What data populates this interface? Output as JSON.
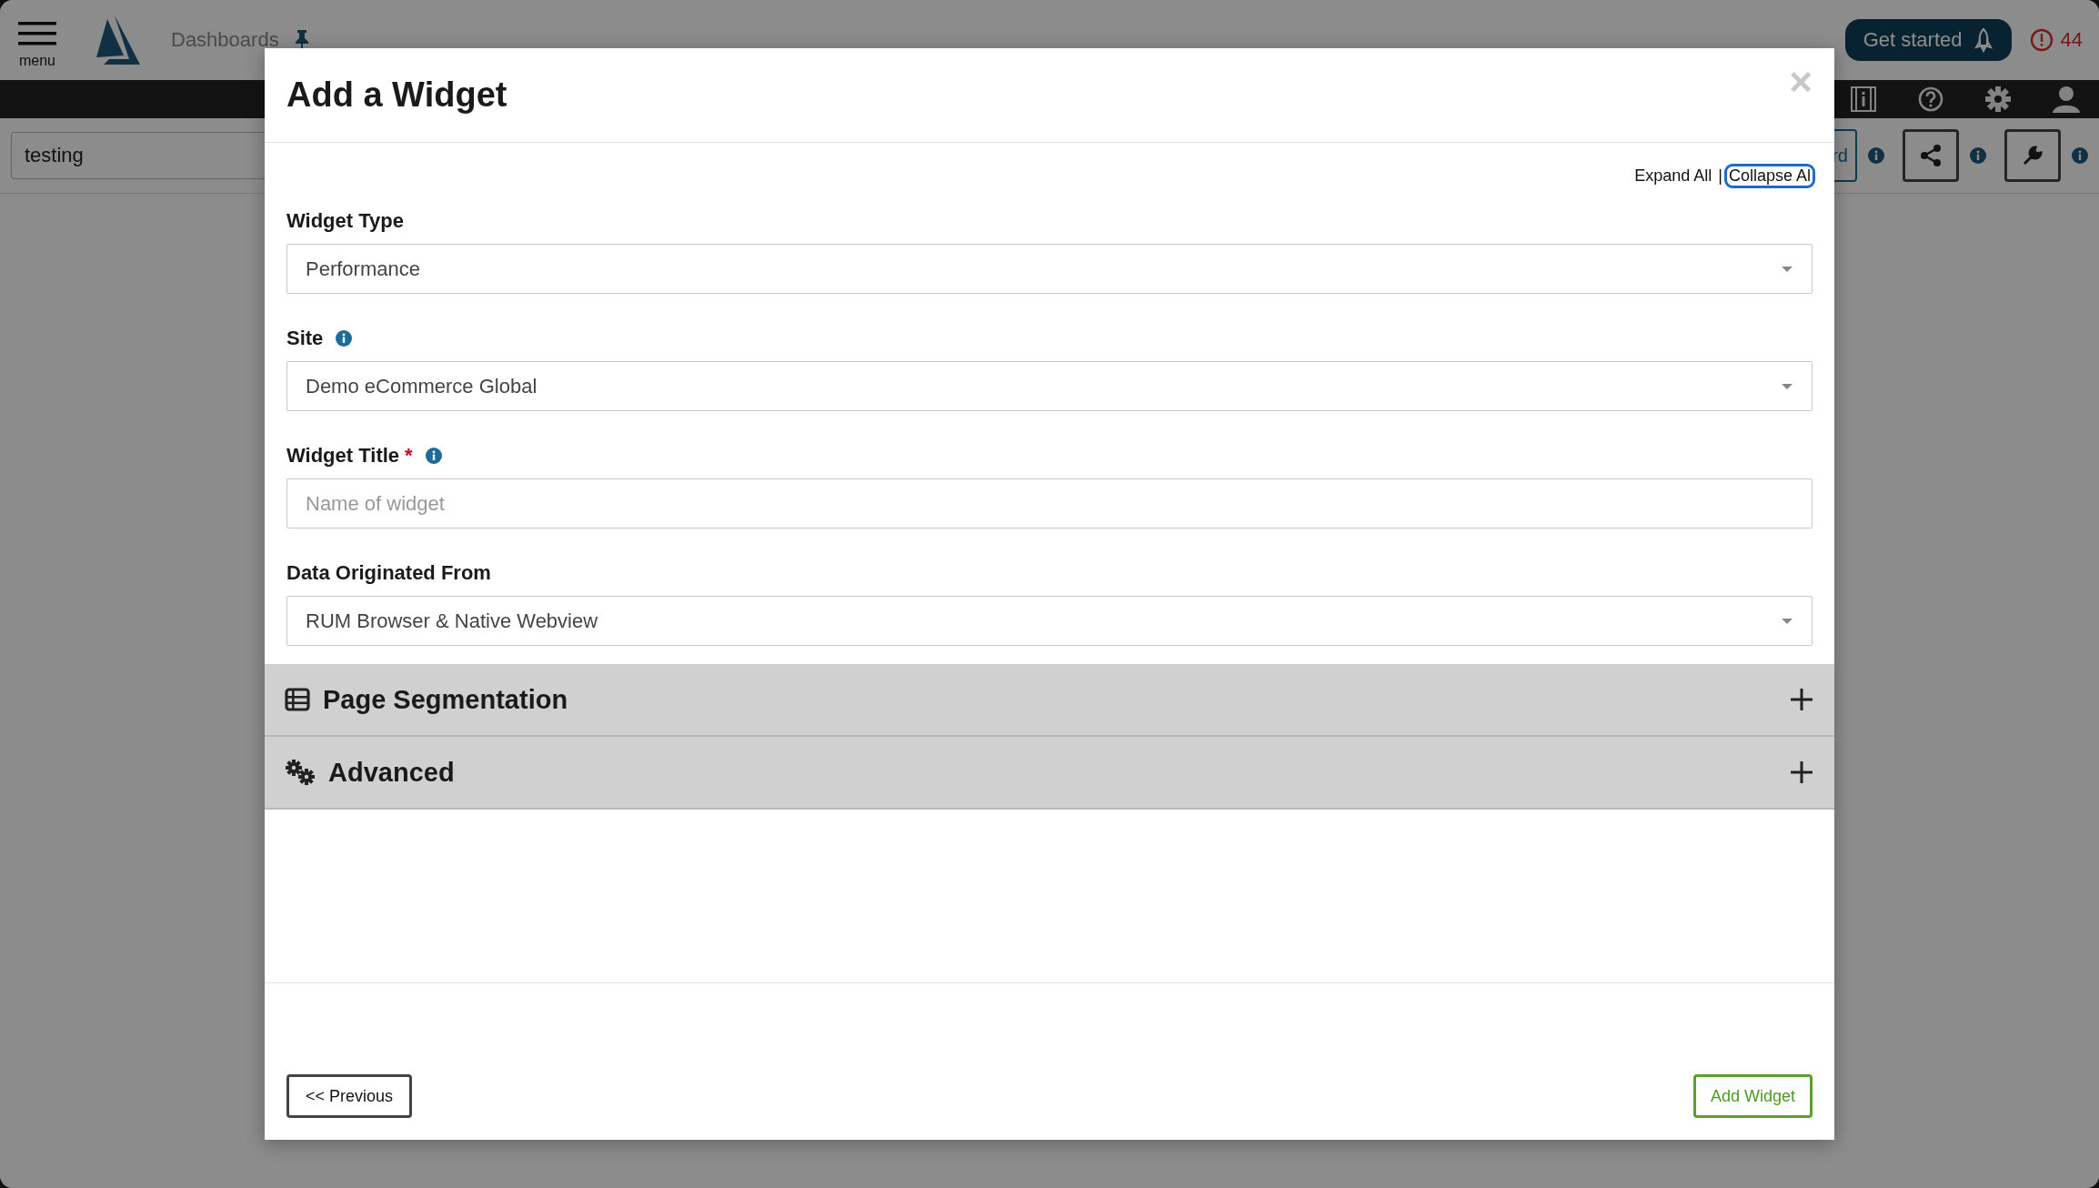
{
  "header": {
    "menu_label": "menu",
    "breadcrumb": "Dashboards",
    "get_started": "Get started",
    "alert_count": "44"
  },
  "toolbar": {
    "dashboard_field": "testing",
    "partial_button": "rd"
  },
  "modal": {
    "title": "Add a Widget",
    "close": "×",
    "expand_all": "Expand All",
    "separator": "|",
    "collapse_all": {
      "label": "Collapse Al",
      "focused": true
    },
    "fields": [
      {
        "kind": "select",
        "label": "Widget Type",
        "required": false,
        "info": false,
        "value": "Performance"
      },
      {
        "kind": "select",
        "label": "Site",
        "required": false,
        "info": true,
        "value": "Demo eCommerce Global"
      },
      {
        "kind": "text",
        "label": "Widget Title",
        "required": true,
        "required_mark": "*",
        "info": true,
        "placeholder": "Name of widget"
      },
      {
        "kind": "select",
        "label": "Data Originated From",
        "required": false,
        "info": false,
        "value": "RUM Browser & Native Webview"
      }
    ],
    "sections": [
      {
        "kind": "table",
        "title": "Page Segmentation",
        "expanded": false
      },
      {
        "kind": "gears",
        "title": "Advanced",
        "expanded": false
      }
    ],
    "buttons": {
      "previous": "<< Previous",
      "add": "Add Widget"
    }
  }
}
